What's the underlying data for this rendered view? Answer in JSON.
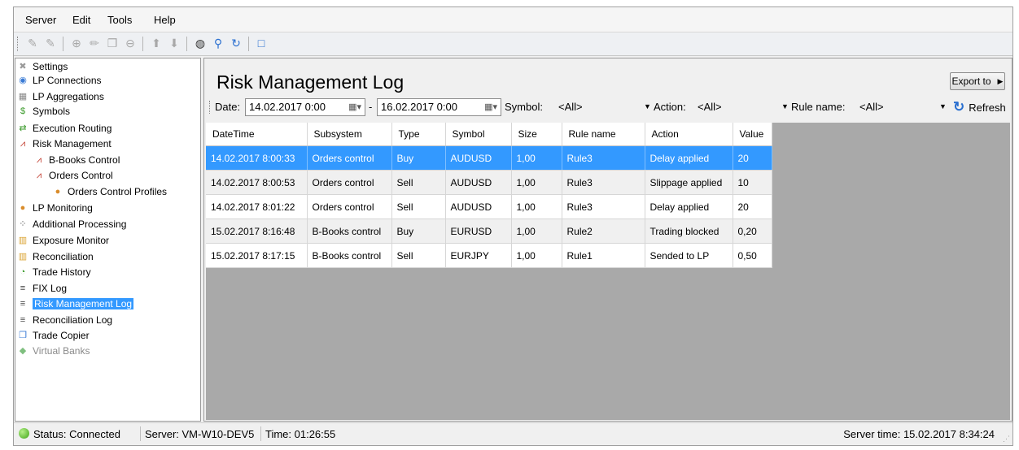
{
  "menu": [
    "Server",
    "Edit",
    "Tools",
    "Help"
  ],
  "sidebar": {
    "items": [
      {
        "label": "Settings",
        "icon": "wrench-icon",
        "glyph": "✖",
        "color": "#9a9a9a",
        "level": 0
      },
      {
        "label": "LP Connections",
        "icon": "globe-icon",
        "glyph": "◉",
        "color": "#3a7bd5",
        "level": 0
      },
      {
        "label": "LP Aggregations",
        "icon": "database-icon",
        "glyph": "▦",
        "color": "#888888",
        "level": 0
      },
      {
        "label": "Symbols",
        "icon": "dollar-icon",
        "glyph": "$",
        "color": "#3a9a2a",
        "level": 0
      },
      {
        "label": "Execution Routing",
        "icon": "routing-icon",
        "glyph": "⇄",
        "color": "#3a9a2a",
        "level": 0
      },
      {
        "label": "Risk Management",
        "icon": "chart-icon",
        "glyph": "⩘",
        "color": "#c0392b",
        "level": 0
      },
      {
        "label": "B-Books Control",
        "icon": "chart-icon",
        "glyph": "⩘",
        "color": "#c0392b",
        "level": 1
      },
      {
        "label": "Orders Control",
        "icon": "chart-icon",
        "glyph": "⩘",
        "color": "#c0392b",
        "level": 1
      },
      {
        "label": "Orders Control Profiles",
        "icon": "user-icon",
        "glyph": "●",
        "color": "#d98c2b",
        "level": 2
      },
      {
        "label": "LP Monitoring",
        "icon": "user-icon",
        "glyph": "●",
        "color": "#d98c2b",
        "level": 0
      },
      {
        "label": "Additional Processing",
        "icon": "spinner-icon",
        "glyph": "⁘",
        "color": "#555555",
        "level": 0
      },
      {
        "label": "Exposure Monitor",
        "icon": "bar-chart-icon",
        "glyph": "▥",
        "color": "#d9a02b",
        "level": 0
      },
      {
        "label": "Reconciliation",
        "icon": "bar-chart-icon",
        "glyph": "▥",
        "color": "#d9a02b",
        "level": 0
      },
      {
        "label": "Trade History",
        "icon": "history-icon",
        "glyph": "◔",
        "color": "#3a9a2a",
        "level": 0
      },
      {
        "label": "FIX Log",
        "icon": "lines-icon",
        "glyph": "≡",
        "color": "#444444",
        "level": 0
      },
      {
        "label": "Risk Management Log",
        "icon": "lines-icon",
        "glyph": "≡",
        "color": "#444444",
        "level": 0,
        "selected": true
      },
      {
        "label": "Reconciliation Log",
        "icon": "lines-icon",
        "glyph": "≡",
        "color": "#444444",
        "level": 0
      },
      {
        "label": "Trade Copier",
        "icon": "copy-icon",
        "glyph": "❐",
        "color": "#3a7bd5",
        "level": 0
      },
      {
        "label": "Virtual Banks",
        "icon": "money-icon",
        "glyph": "◆",
        "color": "#7fbf7f",
        "level": 0,
        "disabled": true
      }
    ]
  },
  "main": {
    "title": "Risk Management Log",
    "export_label": "Export to",
    "filters": {
      "date_label": "Date:",
      "date_from": "14.02.2017  0:00",
      "date_sep": "-",
      "date_to": "16.02.2017  0:00",
      "symbol_label": "Symbol:",
      "symbol_value": "<All>",
      "action_label": "Action:",
      "action_value": "<All>",
      "rule_label": "Rule name:",
      "rule_value": "<All>",
      "refresh_label": "Refresh"
    },
    "table": {
      "columns": [
        "DateTime",
        "Subsystem",
        "Type",
        "Symbol",
        "Size",
        "Rule name",
        "Action",
        "Value"
      ],
      "rows": [
        [
          "14.02.2017 8:00:33",
          "Orders control",
          "Buy",
          "AUDUSD",
          "1,00",
          "Rule3",
          "Delay applied",
          "20"
        ],
        [
          "14.02.2017 8:00:53",
          "Orders control",
          "Sell",
          "AUDUSD",
          "1,00",
          "Rule3",
          "Slippage applied",
          "10"
        ],
        [
          "14.02.2017 8:01:22",
          "Orders control",
          "Sell",
          "AUDUSD",
          "1,00",
          "Rule3",
          "Delay applied",
          "20"
        ],
        [
          "15.02.2017 8:16:48",
          "B-Books control",
          "Buy",
          "EURUSD",
          "1,00",
          "Rule2",
          "Trading blocked",
          "0,20"
        ],
        [
          "15.02.2017 8:17:15",
          "B-Books control",
          "Sell",
          "EURJPY",
          "1,00",
          "Rule1",
          "Sended to LP",
          "0,50"
        ]
      ],
      "selected_row": 0
    }
  },
  "status": {
    "status_text": "Status: Connected",
    "server_text": "Server: VM-W10-DEV5",
    "time_text": "Time: 01:26:55",
    "server_time_text": "Server time: 15.02.2017 8:34:24"
  },
  "colors": {
    "selection": "#3399ff",
    "connected": "#3ea316"
  }
}
